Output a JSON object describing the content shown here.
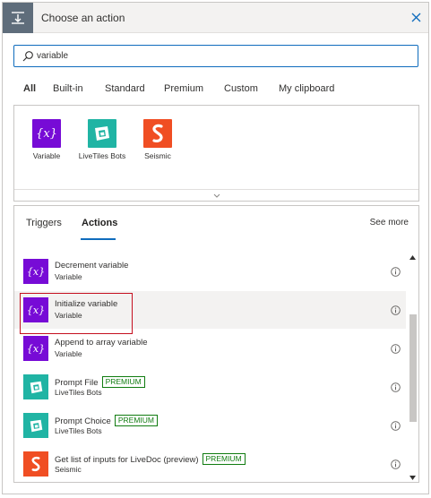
{
  "header": {
    "title": "Choose an action"
  },
  "search": {
    "value": "variable",
    "placeholder": ""
  },
  "filter_tabs": [
    {
      "label": "All",
      "active": true
    },
    {
      "label": "Built-in",
      "active": false
    },
    {
      "label": "Standard",
      "active": false
    },
    {
      "label": "Premium",
      "active": false
    },
    {
      "label": "Custom",
      "active": false
    },
    {
      "label": "My clipboard",
      "active": false
    }
  ],
  "connectors": [
    {
      "label": "Variable",
      "icon": "variable-icon",
      "color": "#770bd6"
    },
    {
      "label": "LiveTiles Bots",
      "icon": "livetiles-bots-icon",
      "color": "#20b4a4"
    },
    {
      "label": "Seismic",
      "icon": "seismic-icon",
      "color": "#f04e23"
    }
  ],
  "action_tabs": {
    "triggers": "Triggers",
    "actions": "Actions",
    "see_more": "See more"
  },
  "actions": [
    {
      "name": "Decrement variable",
      "connector": "Variable",
      "premium": "",
      "icon": "variable-icon",
      "color": "#770bd6"
    },
    {
      "name": "Initialize variable",
      "connector": "Variable",
      "premium": "",
      "icon": "variable-icon",
      "color": "#770bd6",
      "highlighted": true
    },
    {
      "name": "Append to array variable",
      "connector": "Variable",
      "premium": "",
      "icon": "variable-icon",
      "color": "#770bd6"
    },
    {
      "name": "Prompt File",
      "connector": "LiveTiles Bots",
      "premium": "PREMIUM",
      "icon": "livetiles-bots-icon",
      "color": "#20b4a4"
    },
    {
      "name": "Prompt Choice",
      "connector": "LiveTiles Bots",
      "premium": "PREMIUM",
      "icon": "livetiles-bots-icon",
      "color": "#20b4a4"
    },
    {
      "name": "Get list of inputs for LiveDoc (preview)",
      "connector": "Seismic",
      "premium": "PREMIUM",
      "icon": "seismic-icon",
      "color": "#f04e23"
    }
  ],
  "colors": {
    "accent": "#0f6cbd",
    "premium": "#107c10",
    "highlight": "#c50f1f",
    "header_icon_bg": "#5f6d7b"
  }
}
